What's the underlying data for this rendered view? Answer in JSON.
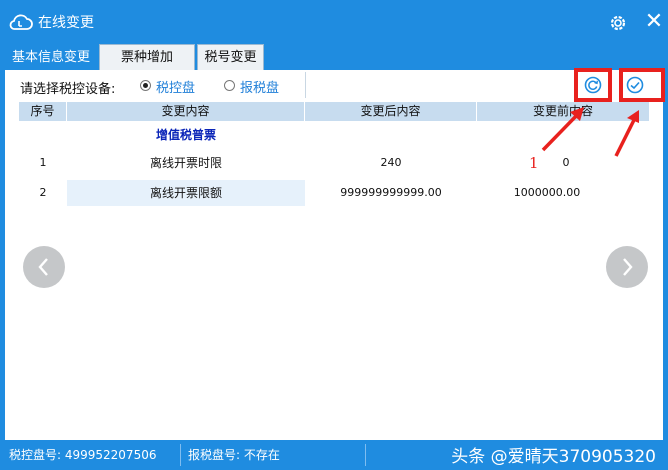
{
  "window": {
    "title": "在线变更",
    "close_glyph": "✕",
    "icons": [
      "cloud-icon",
      "gear-icon",
      "close-icon"
    ]
  },
  "tabs": [
    {
      "label": "基本信息变更",
      "active": true
    },
    {
      "label": "票种增加",
      "active": false
    },
    {
      "label": "税号变更",
      "active": false
    }
  ],
  "device_select": {
    "label": "请选择税控设备:",
    "options": [
      {
        "label": "税控盘",
        "checked": true
      },
      {
        "label": "报税盘",
        "checked": false
      }
    ]
  },
  "table": {
    "columns": [
      "序号",
      "变更内容",
      "变更后内容",
      "变更前内容"
    ],
    "group_title": "增值税普票",
    "rows": [
      {
        "no": "1",
        "item": "离线开票时限",
        "after": "240",
        "before": "0"
      },
      {
        "no": "2",
        "item": "离线开票限额",
        "after": "999999999999.00",
        "before": "1000000.00"
      }
    ]
  },
  "annotation": {
    "marker": "1"
  },
  "statusbar": {
    "tax_disk": "税控盘号: 499952207506",
    "report_disk": "报税盘号: 不存在",
    "watermark": "头条 @爱晴天370905320"
  },
  "colors": {
    "accent": "#1f8ce0",
    "highlight": "#e8211e",
    "group_title": "#0b25b8"
  }
}
